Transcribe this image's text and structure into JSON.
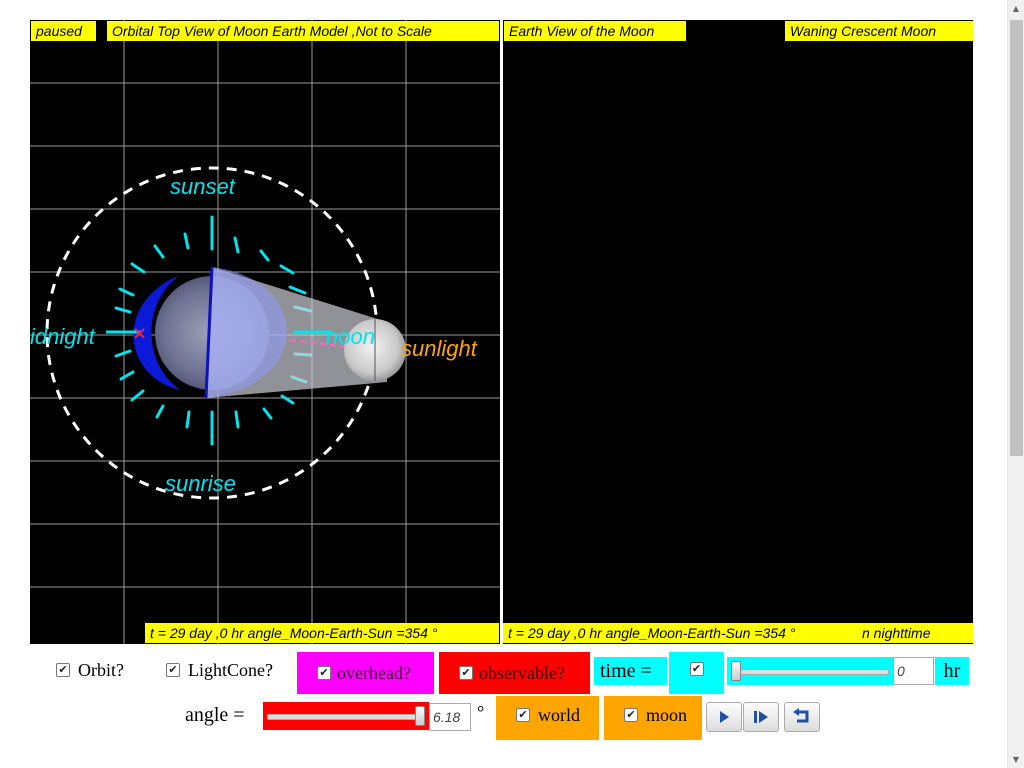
{
  "left_view": {
    "status": "paused",
    "title": "Orbital Top View of Moon Earth Model ,Not to Scale",
    "labels": {
      "sunset": "sunset",
      "sunrise": "sunrise",
      "midnight": "idnight",
      "noon": "noon",
      "sunlight": "sunlight"
    },
    "time_readout": "t = 29 day ,0 hr angle_Moon-Earth-Sun =354 °"
  },
  "right_view": {
    "title": "Earth View of the Moon",
    "phase": "Waning Crescent Moon",
    "time_readout": "t = 29 day ,0 hr angle_Moon-Earth-Sun =354 °",
    "period": "n nighttime"
  },
  "controls": {
    "orbit_label": "Orbit?",
    "lightcone_label": "LightCone?",
    "overhead_label": "overhead?",
    "observable_label": "observable?",
    "time_label": "time =",
    "time_value": "0",
    "time_unit": "hr",
    "time_slider_fraction": 0.0,
    "angle_label": "angle =",
    "angle_value": "6.18",
    "angle_unit": "°",
    "world_label": "world",
    "moon_label": "moon",
    "checked_glyph": "✔"
  },
  "colors": {
    "label_bg": "#ffff00",
    "overhead_bg": "#ff00ff",
    "observable_bg": "#ff0000",
    "time_bg": "#00ffff",
    "world_bg": "#ffa500",
    "marker_cyan": "#00e5ee",
    "sunlight_orange": "#ffa500"
  },
  "icons": [
    "checkbox-icon",
    "play-icon",
    "step-icon",
    "reset-icon"
  ]
}
